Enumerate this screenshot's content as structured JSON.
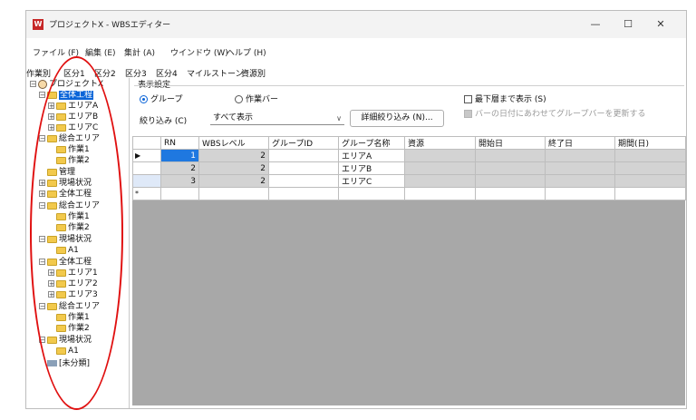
{
  "window": {
    "title": "プロジェクトX - WBSエディター",
    "app_icon": "W",
    "minimize": "—",
    "maximize": "☐",
    "close": "✕"
  },
  "menu": [
    "ファイル (F)",
    "編集 (E)",
    "集計 (A)",
    "ウインドウ (W)",
    "ヘルプ (H)"
  ],
  "tabs": [
    "作業別",
    "区分1",
    "区分2",
    "区分3",
    "区分4",
    "マイルストーン",
    "資源別"
  ],
  "tree": {
    "root": "プロジェクトX",
    "nodes": [
      {
        "label": "全体工程",
        "expander": "−",
        "selected": true
      },
      {
        "label": "エリアA",
        "expander": "+"
      },
      {
        "label": "エリアB",
        "expander": "+"
      },
      {
        "label": "エリアC",
        "expander": "+"
      },
      {
        "label": "総合エリア",
        "expander": "−"
      },
      {
        "label": "作業1",
        "expander": ""
      },
      {
        "label": "作業2",
        "expander": ""
      },
      {
        "label": "管理",
        "expander": ""
      },
      {
        "label": "現場状況",
        "expander": "+"
      },
      {
        "label": "全体工程",
        "expander": "+"
      },
      {
        "label": "総合エリア",
        "expander": "−"
      },
      {
        "label": "作業1",
        "expander": ""
      },
      {
        "label": "作業2",
        "expander": ""
      },
      {
        "label": "現場状況",
        "expander": "−"
      },
      {
        "label": "A1",
        "expander": ""
      },
      {
        "label": "全体工程",
        "expander": "−"
      },
      {
        "label": "エリア1",
        "expander": "+"
      },
      {
        "label": "エリア2",
        "expander": "+"
      },
      {
        "label": "エリア3",
        "expander": "+"
      },
      {
        "label": "総合エリア",
        "expander": "−"
      },
      {
        "label": "作業1",
        "expander": ""
      },
      {
        "label": "作業2",
        "expander": ""
      },
      {
        "label": "現場状況",
        "expander": "−"
      },
      {
        "label": "A1",
        "expander": ""
      },
      {
        "label": "[未分類]",
        "expander": ""
      }
    ]
  },
  "settings": {
    "title": "表示設定",
    "radio_group": "グループ",
    "radio_bar": "作業バー",
    "filter_label": "絞り込み (C)",
    "filter_value": "すべて表示",
    "detail_filter_button": "詳細絞り込み (N)...",
    "bottom_level_label": "最下層まで表示 (S)",
    "update_groupbar_label": "バーの日付にあわせてグループバーを更新する"
  },
  "grid": {
    "columns": [
      "RN",
      "WBSレベル",
      "グループID",
      "グループ名称",
      "資源",
      "開始日",
      "終了日",
      "期間(日)"
    ],
    "rows": [
      {
        "marker": "▶",
        "rn": "1",
        "level": "2",
        "group_id": "",
        "group_name": "エリアA"
      },
      {
        "marker": "",
        "rn": "2",
        "level": "2",
        "group_id": "",
        "group_name": "エリアB"
      },
      {
        "marker": "",
        "rn": "3",
        "level": "2",
        "group_id": "",
        "group_name": "エリアC"
      }
    ],
    "new_row_marker": "*"
  }
}
